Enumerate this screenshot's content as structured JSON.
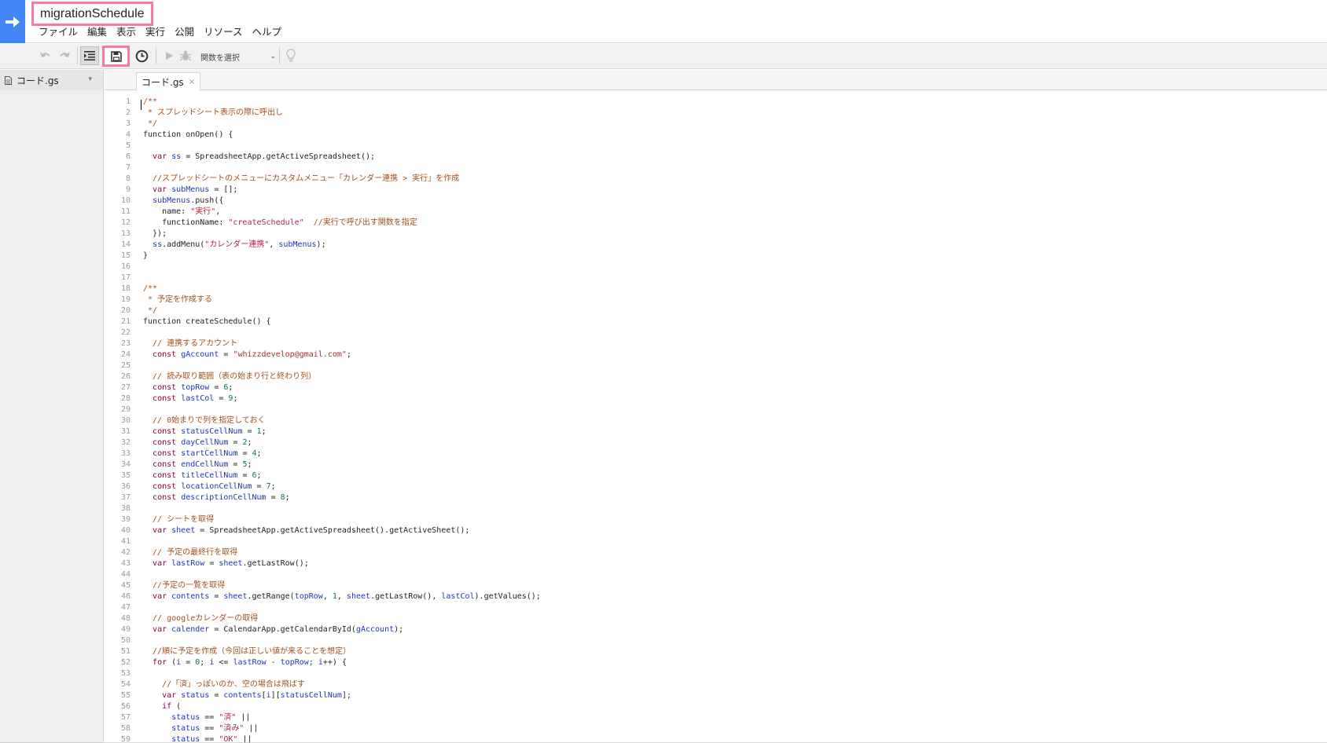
{
  "header": {
    "project_title": "migrationSchedule",
    "menu": [
      "ファイル",
      "編集",
      "表示",
      "実行",
      "公開",
      "リソース",
      "ヘルプ"
    ]
  },
  "toolbar": {
    "icons": [
      "undo-icon",
      "redo-icon",
      "indent-icon",
      "save-icon",
      "clock-icon",
      "run-icon",
      "debug-icon",
      "lightbulb-icon"
    ],
    "function_select_label": "関数を選択",
    "function_select_arrow": "⌄"
  },
  "sidebar": {
    "files": [
      {
        "name": "コード.gs",
        "caret": "▾"
      }
    ]
  },
  "editor": {
    "tab_label": "コード.gs",
    "tab_close": "×",
    "lines": [
      {
        "n": "1",
        "t": [
          [
            "/**",
            "comment"
          ]
        ]
      },
      {
        "n": "2",
        "t": [
          [
            " * スプレッドシート表示の際に呼出し",
            "comment"
          ]
        ]
      },
      {
        "n": "3",
        "t": [
          [
            " */",
            "comment"
          ]
        ]
      },
      {
        "n": "4",
        "t": [
          [
            "function onOpen() {",
            "plain"
          ]
        ]
      },
      {
        "n": "5",
        "t": []
      },
      {
        "n": "6",
        "t": [
          [
            "  ",
            "plain"
          ],
          [
            "var",
            "kw"
          ],
          [
            " ",
            "plain"
          ],
          [
            "ss",
            "var"
          ],
          [
            " = SpreadsheetApp.getActiveSpreadsheet();",
            "plain"
          ]
        ]
      },
      {
        "n": "7",
        "t": []
      },
      {
        "n": "8",
        "t": [
          [
            "  //スプレッドシートのメニューにカスタムメニュー「カレンダー連携 > 実行」を作成",
            "comment"
          ]
        ]
      },
      {
        "n": "9",
        "t": [
          [
            "  ",
            "plain"
          ],
          [
            "var",
            "kw"
          ],
          [
            " ",
            "plain"
          ],
          [
            "subMenus",
            "var"
          ],
          [
            " = [];",
            "plain"
          ]
        ]
      },
      {
        "n": "10",
        "t": [
          [
            "  ",
            "plain"
          ],
          [
            "subMenus",
            "var"
          ],
          [
            ".push({",
            "plain"
          ]
        ]
      },
      {
        "n": "11",
        "t": [
          [
            "    name: ",
            "plain"
          ],
          [
            "\"実行\"",
            "str"
          ],
          [
            ",",
            "plain"
          ]
        ]
      },
      {
        "n": "12",
        "t": [
          [
            "    functionName: ",
            "plain"
          ],
          [
            "\"createSchedule\"",
            "str"
          ],
          [
            "  ",
            "plain"
          ],
          [
            "//実行で呼び出す関数を指定",
            "comment"
          ]
        ]
      },
      {
        "n": "13",
        "t": [
          [
            "  });",
            "plain"
          ]
        ]
      },
      {
        "n": "14",
        "t": [
          [
            "  ",
            "plain"
          ],
          [
            "ss",
            "var"
          ],
          [
            ".addMenu(",
            "plain"
          ],
          [
            "\"カレンダー連携\"",
            "str"
          ],
          [
            ", ",
            "plain"
          ],
          [
            "subMenus",
            "var"
          ],
          [
            ");",
            "plain"
          ]
        ]
      },
      {
        "n": "15",
        "t": [
          [
            "}",
            "plain"
          ]
        ]
      },
      {
        "n": "16",
        "t": []
      },
      {
        "n": "17",
        "t": []
      },
      {
        "n": "18",
        "t": [
          [
            "/**",
            "comment"
          ]
        ]
      },
      {
        "n": "19",
        "t": [
          [
            " * 予定を作成する",
            "comment"
          ]
        ]
      },
      {
        "n": "20",
        "t": [
          [
            " */",
            "comment"
          ]
        ]
      },
      {
        "n": "21",
        "t": [
          [
            "function createSchedule() {",
            "plain"
          ]
        ]
      },
      {
        "n": "22",
        "t": []
      },
      {
        "n": "23",
        "t": [
          [
            "  // 連携するアカウント",
            "comment"
          ]
        ]
      },
      {
        "n": "24",
        "t": [
          [
            "  ",
            "plain"
          ],
          [
            "const",
            "kw"
          ],
          [
            " ",
            "plain"
          ],
          [
            "gAccount",
            "var"
          ],
          [
            " = ",
            "plain"
          ],
          [
            "\"whizzdevelop@gmail.com\"",
            "str"
          ],
          [
            ";",
            "plain"
          ]
        ]
      },
      {
        "n": "25",
        "t": []
      },
      {
        "n": "26",
        "t": [
          [
            "  // 読み取り範囲（表の始まり行と終わり列）",
            "comment"
          ]
        ]
      },
      {
        "n": "27",
        "t": [
          [
            "  ",
            "plain"
          ],
          [
            "const",
            "kw"
          ],
          [
            " ",
            "plain"
          ],
          [
            "topRow",
            "var"
          ],
          [
            " = ",
            "plain"
          ],
          [
            "6",
            "num"
          ],
          [
            ";",
            "plain"
          ]
        ]
      },
      {
        "n": "28",
        "t": [
          [
            "  ",
            "plain"
          ],
          [
            "const",
            "kw"
          ],
          [
            " ",
            "plain"
          ],
          [
            "lastCol",
            "var"
          ],
          [
            " = ",
            "plain"
          ],
          [
            "9",
            "num"
          ],
          [
            ";",
            "plain"
          ]
        ]
      },
      {
        "n": "29",
        "t": []
      },
      {
        "n": "30",
        "t": [
          [
            "  // 0始まりで列を指定しておく",
            "comment"
          ]
        ]
      },
      {
        "n": "31",
        "t": [
          [
            "  ",
            "plain"
          ],
          [
            "const",
            "kw"
          ],
          [
            " ",
            "plain"
          ],
          [
            "statusCellNum",
            "var"
          ],
          [
            " = ",
            "plain"
          ],
          [
            "1",
            "num"
          ],
          [
            ";",
            "plain"
          ]
        ]
      },
      {
        "n": "32",
        "t": [
          [
            "  ",
            "plain"
          ],
          [
            "const",
            "kw"
          ],
          [
            " ",
            "plain"
          ],
          [
            "dayCellNum",
            "var"
          ],
          [
            " = ",
            "plain"
          ],
          [
            "2",
            "num"
          ],
          [
            ";",
            "plain"
          ]
        ]
      },
      {
        "n": "33",
        "t": [
          [
            "  ",
            "plain"
          ],
          [
            "const",
            "kw"
          ],
          [
            " ",
            "plain"
          ],
          [
            "startCellNum",
            "var"
          ],
          [
            " = ",
            "plain"
          ],
          [
            "4",
            "num"
          ],
          [
            ";",
            "plain"
          ]
        ]
      },
      {
        "n": "34",
        "t": [
          [
            "  ",
            "plain"
          ],
          [
            "const",
            "kw"
          ],
          [
            " ",
            "plain"
          ],
          [
            "endCellNum",
            "var"
          ],
          [
            " = ",
            "plain"
          ],
          [
            "5",
            "num"
          ],
          [
            ";",
            "plain"
          ]
        ]
      },
      {
        "n": "35",
        "t": [
          [
            "  ",
            "plain"
          ],
          [
            "const",
            "kw"
          ],
          [
            " ",
            "plain"
          ],
          [
            "titleCellNum",
            "var"
          ],
          [
            " = ",
            "plain"
          ],
          [
            "6",
            "num"
          ],
          [
            ";",
            "plain"
          ]
        ]
      },
      {
        "n": "36",
        "t": [
          [
            "  ",
            "plain"
          ],
          [
            "const",
            "kw"
          ],
          [
            " ",
            "plain"
          ],
          [
            "locationCellNum",
            "var"
          ],
          [
            " = ",
            "plain"
          ],
          [
            "7",
            "num"
          ],
          [
            ";",
            "plain"
          ]
        ]
      },
      {
        "n": "37",
        "t": [
          [
            "  ",
            "plain"
          ],
          [
            "const",
            "kw"
          ],
          [
            " ",
            "plain"
          ],
          [
            "descriptionCellNum",
            "var"
          ],
          [
            " = ",
            "plain"
          ],
          [
            "8",
            "num"
          ],
          [
            ";",
            "plain"
          ]
        ]
      },
      {
        "n": "38",
        "t": []
      },
      {
        "n": "39",
        "t": [
          [
            "  // シートを取得",
            "comment"
          ]
        ]
      },
      {
        "n": "40",
        "t": [
          [
            "  ",
            "plain"
          ],
          [
            "var",
            "kw"
          ],
          [
            " ",
            "plain"
          ],
          [
            "sheet",
            "var"
          ],
          [
            " = SpreadsheetApp.getActiveSpreadsheet().getActiveSheet();",
            "plain"
          ]
        ]
      },
      {
        "n": "41",
        "t": []
      },
      {
        "n": "42",
        "t": [
          [
            "  // 予定の最終行を取得",
            "comment"
          ]
        ]
      },
      {
        "n": "43",
        "t": [
          [
            "  ",
            "plain"
          ],
          [
            "var",
            "kw"
          ],
          [
            " ",
            "plain"
          ],
          [
            "lastRow",
            "var"
          ],
          [
            " = ",
            "plain"
          ],
          [
            "sheet",
            "var"
          ],
          [
            ".getLastRow();",
            "plain"
          ]
        ]
      },
      {
        "n": "44",
        "t": []
      },
      {
        "n": "45",
        "t": [
          [
            "  //予定の一覧を取得",
            "comment"
          ]
        ]
      },
      {
        "n": "46",
        "t": [
          [
            "  ",
            "plain"
          ],
          [
            "var",
            "kw"
          ],
          [
            " ",
            "plain"
          ],
          [
            "contents",
            "var"
          ],
          [
            " = ",
            "plain"
          ],
          [
            "sheet",
            "var"
          ],
          [
            ".getRange(",
            "plain"
          ],
          [
            "topRow",
            "var"
          ],
          [
            ", ",
            "plain"
          ],
          [
            "1",
            "num"
          ],
          [
            ", ",
            "plain"
          ],
          [
            "sheet",
            "var"
          ],
          [
            ".getLastRow(), ",
            "plain"
          ],
          [
            "lastCol",
            "var"
          ],
          [
            ").getValues();",
            "plain"
          ]
        ]
      },
      {
        "n": "47",
        "t": []
      },
      {
        "n": "48",
        "t": [
          [
            "  // googleカレンダーの取得",
            "comment"
          ]
        ]
      },
      {
        "n": "49",
        "t": [
          [
            "  ",
            "plain"
          ],
          [
            "var",
            "kw"
          ],
          [
            " ",
            "plain"
          ],
          [
            "calender",
            "var"
          ],
          [
            " = CalendarApp.getCalendarById(",
            "plain"
          ],
          [
            "gAccount",
            "var"
          ],
          [
            ");",
            "plain"
          ]
        ]
      },
      {
        "n": "50",
        "t": []
      },
      {
        "n": "51",
        "t": [
          [
            "  //順に予定を作成（今回は正しい値が来ることを想定）",
            "comment"
          ]
        ]
      },
      {
        "n": "52",
        "t": [
          [
            "  ",
            "plain"
          ],
          [
            "for",
            "kw"
          ],
          [
            " (",
            "plain"
          ],
          [
            "i",
            "var"
          ],
          [
            " = ",
            "plain"
          ],
          [
            "0",
            "num"
          ],
          [
            "; ",
            "plain"
          ],
          [
            "i",
            "var"
          ],
          [
            " <= ",
            "plain"
          ],
          [
            "lastRow",
            "var"
          ],
          [
            " - ",
            "plain"
          ],
          [
            "topRow",
            "var"
          ],
          [
            "; ",
            "plain"
          ],
          [
            "i",
            "var"
          ],
          [
            "++) {",
            "plain"
          ]
        ]
      },
      {
        "n": "53",
        "t": []
      },
      {
        "n": "54",
        "t": [
          [
            "    //「済」っぽいのか、空の場合は飛ばす",
            "comment"
          ]
        ]
      },
      {
        "n": "55",
        "t": [
          [
            "    ",
            "plain"
          ],
          [
            "var",
            "kw"
          ],
          [
            " ",
            "plain"
          ],
          [
            "status",
            "var"
          ],
          [
            " = ",
            "plain"
          ],
          [
            "contents",
            "var"
          ],
          [
            "[",
            "plain"
          ],
          [
            "i",
            "var"
          ],
          [
            "][",
            "plain"
          ],
          [
            "statusCellNum",
            "var"
          ],
          [
            "];",
            "plain"
          ]
        ]
      },
      {
        "n": "56",
        "t": [
          [
            "    ",
            "plain"
          ],
          [
            "if",
            "kw"
          ],
          [
            " (",
            "plain"
          ]
        ]
      },
      {
        "n": "57",
        "t": [
          [
            "      ",
            "plain"
          ],
          [
            "status",
            "var"
          ],
          [
            " == ",
            "plain"
          ],
          [
            "\"済\"",
            "str"
          ],
          [
            " ||",
            "plain"
          ]
        ]
      },
      {
        "n": "58",
        "t": [
          [
            "      ",
            "plain"
          ],
          [
            "status",
            "var"
          ],
          [
            " == ",
            "plain"
          ],
          [
            "\"済み\"",
            "str"
          ],
          [
            " ||",
            "plain"
          ]
        ]
      },
      {
        "n": "59",
        "t": [
          [
            "      ",
            "plain"
          ],
          [
            "status",
            "var"
          ],
          [
            " == ",
            "plain"
          ],
          [
            "\"OK\"",
            "str"
          ],
          [
            " ||",
            "plain"
          ]
        ]
      }
    ]
  },
  "colors": {
    "accent_blue": "#4285f4",
    "highlight_pink": "#f47ba2",
    "comment": "#a1501b",
    "keyword": "#8b0045",
    "variable": "#2034c2",
    "string": "#b2263e",
    "number": "#097c4e"
  }
}
